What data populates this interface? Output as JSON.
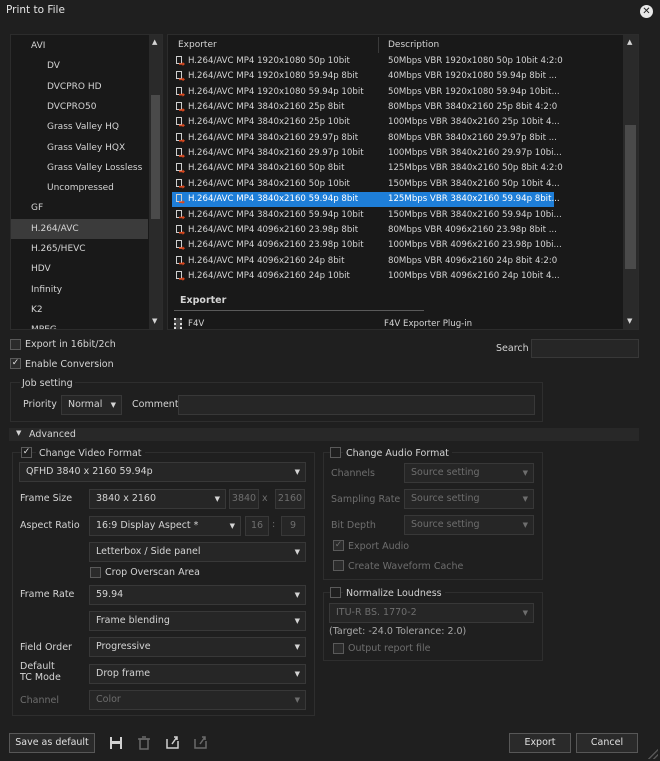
{
  "window": {
    "title": "Print to File",
    "close_icon": "close-icon"
  },
  "tree": {
    "items": [
      {
        "label": "AVI",
        "indent": 1
      },
      {
        "label": "DV",
        "indent": 2
      },
      {
        "label": "DVCPRO HD",
        "indent": 2
      },
      {
        "label": "DVCPRO50",
        "indent": 2
      },
      {
        "label": "Grass Valley HQ",
        "indent": 2
      },
      {
        "label": "Grass Valley HQX",
        "indent": 2
      },
      {
        "label": "Grass Valley Lossless",
        "indent": 2
      },
      {
        "label": "Uncompressed",
        "indent": 2
      },
      {
        "label": "GF",
        "indent": 1
      },
      {
        "label": "H.264/AVC",
        "indent": 1,
        "selected": true
      },
      {
        "label": "H.265/HEVC",
        "indent": 1
      },
      {
        "label": "HDV",
        "indent": 1
      },
      {
        "label": "Infinity",
        "indent": 1
      },
      {
        "label": "K2",
        "indent": 1
      },
      {
        "label": "MPEG",
        "indent": 1
      }
    ]
  },
  "exporter_list": {
    "columns": {
      "exporter": "Exporter",
      "description": "Description"
    },
    "rows": [
      {
        "exporter": "H.264/AVC MP4 1920x1080 50p 10bit",
        "description": "50Mbps VBR 1920x1080 50p 10bit 4:2:0"
      },
      {
        "exporter": "H.264/AVC MP4 1920x1080 59.94p 8bit",
        "description": "40Mbps VBR 1920x1080 59.94p 8bit ..."
      },
      {
        "exporter": "H.264/AVC MP4 1920x1080 59.94p 10bit",
        "description": "50Mbps VBR 1920x1080 59.94p 10bit..."
      },
      {
        "exporter": "H.264/AVC MP4 3840x2160 25p 8bit",
        "description": "80Mbps VBR 3840x2160 25p 8bit 4:2:0"
      },
      {
        "exporter": "H.264/AVC MP4 3840x2160 25p 10bit",
        "description": "100Mbps VBR 3840x2160 25p 10bit 4..."
      },
      {
        "exporter": "H.264/AVC MP4 3840x2160 29.97p 8bit",
        "description": "80Mbps VBR 3840x2160 29.97p 8bit ..."
      },
      {
        "exporter": "H.264/AVC MP4 3840x2160 29.97p 10bit",
        "description": "100Mbps VBR 3840x2160 29.97p 10bi..."
      },
      {
        "exporter": "H.264/AVC MP4 3840x2160 50p 8bit",
        "description": "125Mbps VBR 3840x2160 50p 8bit 4:2:0"
      },
      {
        "exporter": "H.264/AVC MP4 3840x2160 50p 10bit",
        "description": "150Mbps VBR 3840x2160 50p 10bit 4..."
      },
      {
        "exporter": "H.264/AVC MP4 3840x2160 59.94p 8bit",
        "description": "125Mbps VBR 3840x2160 59.94p 8bit...",
        "selected": true
      },
      {
        "exporter": "H.264/AVC MP4 3840x2160 59.94p 10bit",
        "description": "150Mbps VBR 3840x2160 59.94p 10bi..."
      },
      {
        "exporter": "H.264/AVC MP4 4096x2160 23.98p 8bit",
        "description": "80Mbps VBR 4096x2160 23.98p 8bit ..."
      },
      {
        "exporter": "H.264/AVC MP4 4096x2160 23.98p 10bit",
        "description": "100Mbps VBR 4096x2160 23.98p 10bi..."
      },
      {
        "exporter": "H.264/AVC MP4 4096x2160 24p 8bit",
        "description": "80Mbps VBR 4096x2160 24p 8bit 4:2:0"
      },
      {
        "exporter": "H.264/AVC MP4 4096x2160 24p 10bit",
        "description": "100Mbps VBR 4096x2160 24p 10bit 4..."
      }
    ],
    "group_header": "Exporter",
    "plugin_row": {
      "exporter": "F4V",
      "description": "F4V Exporter Plug-in"
    }
  },
  "options": {
    "export_16bit": "Export in 16bit/2ch",
    "enable_conversion": "Enable Conversion",
    "search_label": "Search",
    "search_value": ""
  },
  "job_setting": {
    "title": "Job setting",
    "priority_label": "Priority",
    "priority_value": "Normal",
    "comment_label": "Comment",
    "comment_value": ""
  },
  "advanced": {
    "title": "Advanced"
  },
  "video": {
    "title": "Change Video Format",
    "format": "QFHD 3840 x 2160 59.94p",
    "frame_size_label": "Frame Size",
    "frame_size": "3840 x 2160",
    "width": "3840",
    "x_sep": "x",
    "height": "2160",
    "aspect_label": "Aspect Ratio",
    "aspect": "16:9 Display Aspect *",
    "aspect_w": "16",
    "colon": ":",
    "aspect_h": "9",
    "letterbox": "Letterbox / Side panel",
    "crop_label": "Crop Overscan Area",
    "frame_rate_label": "Frame Rate",
    "frame_rate": "59.94",
    "frame_blending": "Frame blending",
    "field_order_label": "Field Order",
    "field_order": "Progressive",
    "tc_mode_label": "Default\nTC Mode",
    "tc_mode": "Drop frame",
    "channel_label": "Channel",
    "channel": "Color"
  },
  "audio": {
    "title": "Change Audio Format",
    "channels_label": "Channels",
    "channels": "Source setting",
    "sampling_label": "Sampling Rate",
    "sampling": "Source setting",
    "bitdepth_label": "Bit Depth",
    "bitdepth": "Source setting",
    "export_audio": "Export Audio",
    "waveform": "Create Waveform Cache"
  },
  "loudness": {
    "title": "Normalize Loudness",
    "standard": "ITU-R BS. 1770-2",
    "target": "(Target: -24.0 Tolerance: 2.0)",
    "report": "Output report file"
  },
  "footer": {
    "save_default": "Save as default",
    "export": "Export",
    "cancel": "Cancel"
  },
  "colors": {
    "selection": "#1e7ed8",
    "accent_arrow": "#d9481e"
  }
}
